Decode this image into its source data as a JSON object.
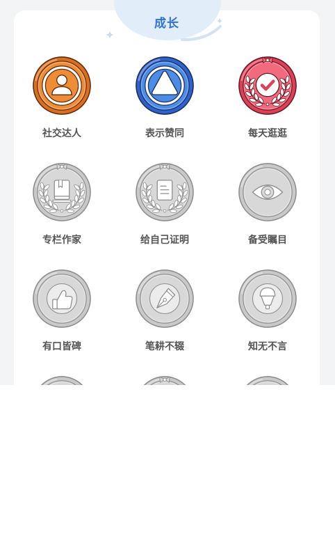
{
  "header": {
    "title": "成长"
  },
  "theme": {
    "accent": "#2f74d6",
    "label": "#555555",
    "page_bg": "#f2f4f6",
    "card_bg": "#ffffff"
  },
  "palettes": {
    "orange": {
      "rim": "#dc6e1f",
      "face": "#ef8d37",
      "line": "#5e2c0c"
    },
    "blue": {
      "rim": "#2f63c9",
      "face": "#4b8de6",
      "line": "#1c2c5e"
    },
    "red": {
      "rim": "#dc4157",
      "face": "#f26a7d",
      "line": "#6b1824"
    },
    "gray": {
      "rim": "#c9c9c9",
      "face": "#d8d8d8",
      "line": "#8e8e8e"
    }
  },
  "badges": [
    {
      "label": "社交达人",
      "icon": "person-icon",
      "palette": "orange",
      "laurel": false
    },
    {
      "label": "表示赞同",
      "icon": "triangle-icon",
      "palette": "blue",
      "laurel": false
    },
    {
      "label": "每天逛逛",
      "icon": "check-icon",
      "palette": "red",
      "laurel": true
    },
    {
      "label": "专栏作家",
      "icon": "book-icon",
      "palette": "gray",
      "laurel": true
    },
    {
      "label": "给自己证明",
      "icon": "document-icon",
      "palette": "gray",
      "laurel": true
    },
    {
      "label": "备受瞩目",
      "icon": "eye-icon",
      "palette": "gray",
      "laurel": false
    },
    {
      "label": "有口皆碑",
      "icon": "thumbs-up-icon",
      "palette": "gray",
      "laurel": false
    },
    {
      "label": "笔耕不辍",
      "icon": "pen-icon",
      "palette": "gray",
      "laurel": false
    },
    {
      "label": "知无不言",
      "icon": "microphone-icon",
      "palette": "gray",
      "laurel": false
    },
    {
      "palette": "gray",
      "laurel": false
    },
    {
      "palette": "gray",
      "laurel": true
    },
    {
      "palette": "gray",
      "laurel": false
    }
  ]
}
